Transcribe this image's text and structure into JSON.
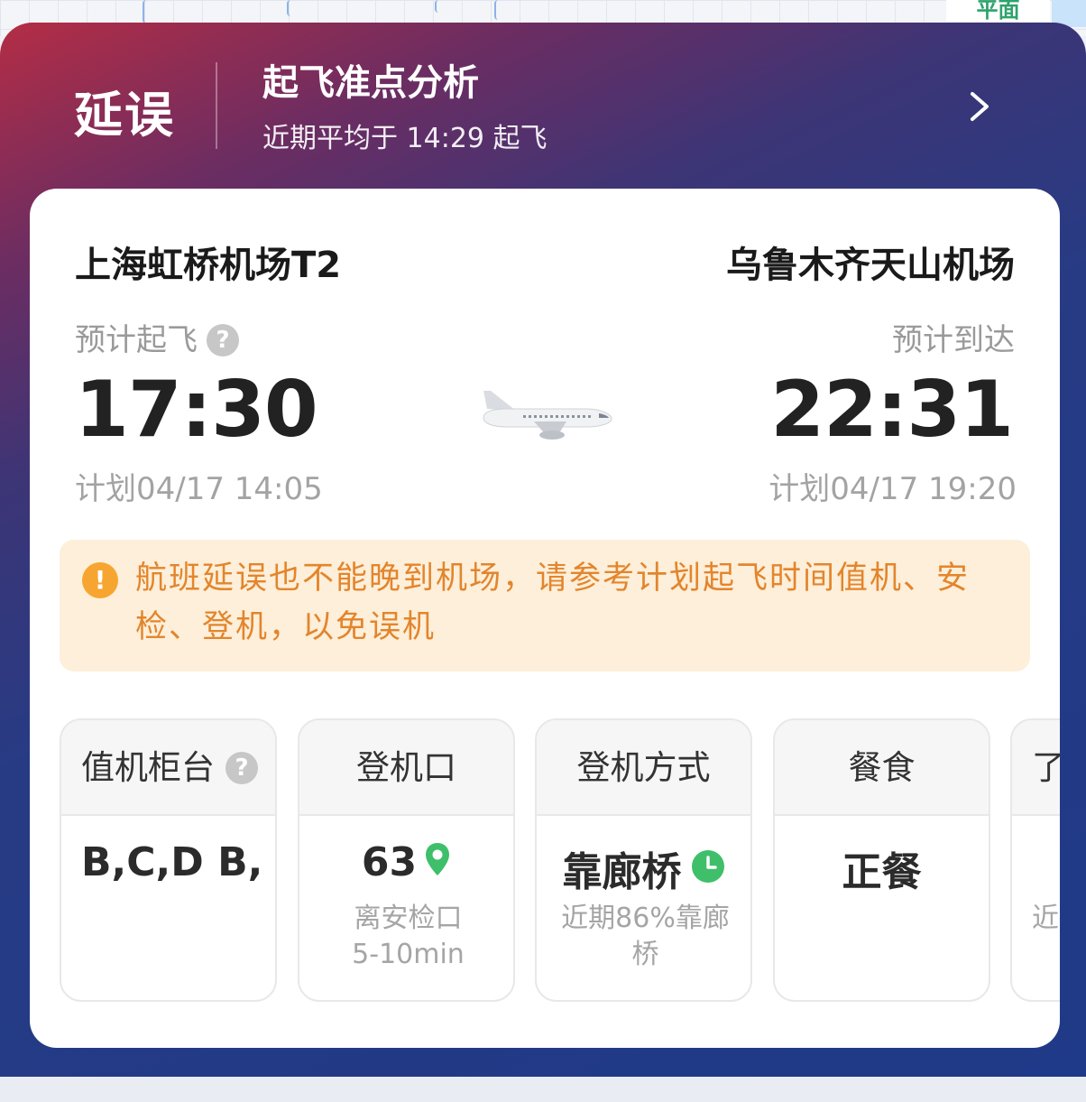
{
  "map": {
    "mode_label": "平面"
  },
  "status": {
    "label": "延误",
    "analysis_title": "起飞准点分析",
    "analysis_subtitle": "近期平均于 14:29 起飞"
  },
  "flight": {
    "departure_airport": "上海虹桥机场T2",
    "arrival_airport": "乌鲁木齐天山机场",
    "departure_label": "预计起飞",
    "arrival_label": "预计到达",
    "departure_time": "17:30",
    "arrival_time": "22:31",
    "departure_planned": "计划04/17 14:05",
    "arrival_planned": "计划04/17 19:20"
  },
  "notice": {
    "icon_glyph": "!",
    "text": "航班延误也不能晚到机场，请参考计划起飞时间值机、安检、登机，以免误机"
  },
  "tiles": {
    "checkin": {
      "title": "值机柜台",
      "value": "B,C,D    B,"
    },
    "gate": {
      "title": "登机口",
      "value": "63",
      "sub_line1": "离安检口",
      "sub_line2": "5-10min"
    },
    "boarding": {
      "title": "登机方式",
      "value": "靠廊桥",
      "sub_line1": "近期86%靠廊",
      "sub_line2": "桥"
    },
    "meal": {
      "title": "餐食",
      "value": "正餐"
    },
    "partial": {
      "title": "了",
      "sub_line1": "近"
    }
  },
  "colors": {
    "status_gradient_start": "#b42d45",
    "status_gradient_end": "#1f3a88",
    "notice_background": "#fdefd9",
    "notice_text": "#e3852c",
    "notice_icon": "#f7a531",
    "gate_pin": "#3fbf6a",
    "clock_green": "#3fbf6a"
  },
  "icons": {
    "help": "question-mark-circle",
    "arrow": "chevron-right",
    "plane": "airplane",
    "notice": "exclamation-circle",
    "gate": "location-pin",
    "boarding": "clock"
  }
}
